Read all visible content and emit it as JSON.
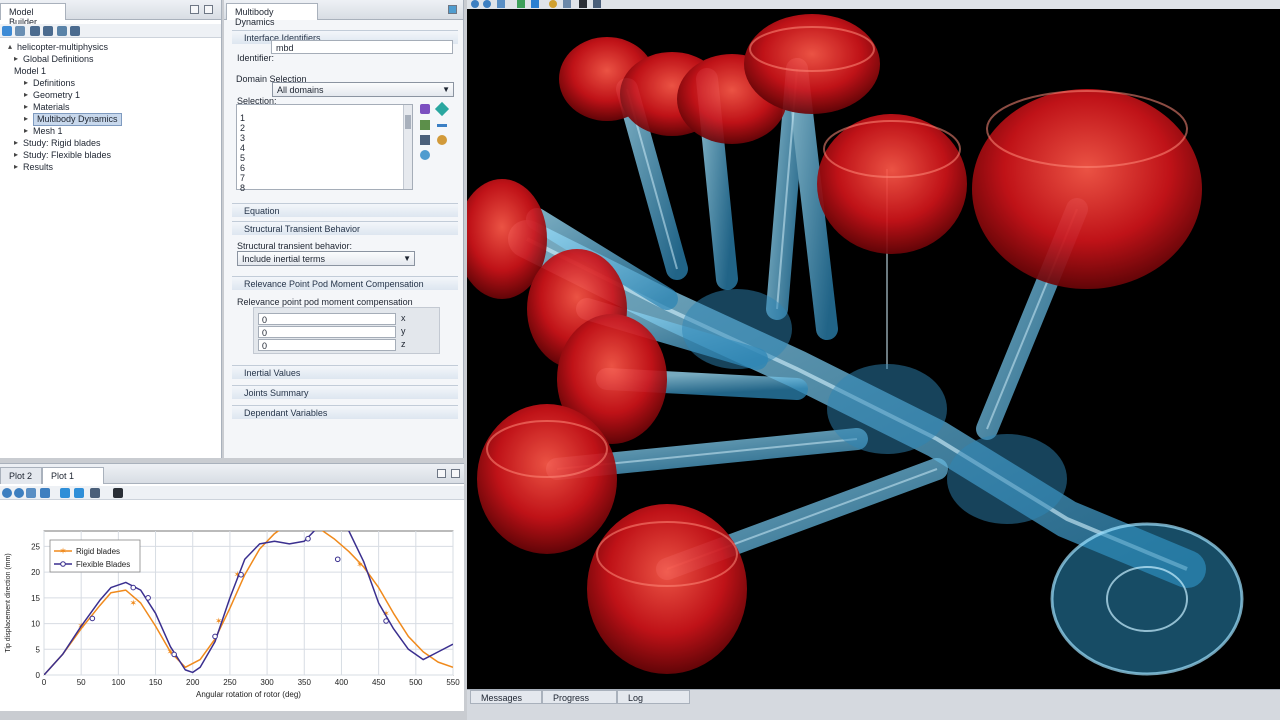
{
  "model_builder": {
    "title": "Model Builder",
    "tree": [
      {
        "label": "helicopter-multiphysics",
        "arrow": "▴",
        "level": 0
      },
      {
        "label": "Global Definitions",
        "arrow": "▸",
        "level": 1
      },
      {
        "label": "Model 1",
        "arrow": "",
        "level": 1
      },
      {
        "label": "Definitions",
        "arrow": "▸",
        "level": 2
      },
      {
        "label": "Geometry 1",
        "arrow": "▸",
        "level": 2
      },
      {
        "label": "Materials",
        "arrow": "▸",
        "level": 2
      },
      {
        "label": "Multibody Dynamics",
        "arrow": "▸",
        "level": 2,
        "selected": true
      },
      {
        "label": "Mesh 1",
        "arrow": "▸",
        "level": 2
      },
      {
        "label": "Study: Rigid blades",
        "arrow": "▸",
        "level": 1
      },
      {
        "label": "Study: Flexible blades",
        "arrow": "▸",
        "level": 1
      },
      {
        "label": "Results",
        "arrow": "▸",
        "level": 1
      }
    ]
  },
  "settings": {
    "title": "Multibody Dynamics",
    "interface_identifiers": "Interface Identifiers",
    "identifier_label": "Identifier:",
    "identifier_value": "mbd",
    "domain_selection": "Domain Selection",
    "selection_label": "Selection:",
    "selection_value": "All domains",
    "domains": [
      "1",
      "2",
      "3",
      "4",
      "5",
      "6",
      "7",
      "8"
    ],
    "equation": "Equation",
    "structural_transient": "Structural Transient Behavior",
    "structural_transient_label": "Structural transient behavior:",
    "structural_transient_value": "Include inertial terms",
    "relevance": "Relevance Point Pod Moment Compensation",
    "relevance_label": "Relevance point pod moment compensation",
    "coords": [
      {
        "value": "0",
        "axis": "x"
      },
      {
        "value": "0",
        "axis": "y"
      },
      {
        "value": "0",
        "axis": "z"
      }
    ],
    "inertial_values": "Inertial Values",
    "joints_summary": "Joints Summary",
    "dependent_variables": "Dependant Variables"
  },
  "plot_tabs": {
    "plot2": "Plot 2",
    "plot1": "Plot 1"
  },
  "bottom_tabs": {
    "messages": "Messages",
    "progress": "Progress",
    "log": "Log"
  },
  "colors": {
    "rigid": "#f08a1c",
    "flexible": "#3a2f8f",
    "grid": "#d7dce3"
  },
  "chart_data": {
    "type": "line",
    "xlabel": "Angular rotation of rotor (deg)",
    "ylabel": "Tip displacement direction (mm)",
    "xlim": [
      0,
      550
    ],
    "ylim": [
      0,
      28
    ],
    "xticks": [
      0,
      50,
      100,
      150,
      200,
      250,
      300,
      350,
      400,
      450,
      500,
      550
    ],
    "yticks": [
      0,
      5,
      10,
      15,
      20,
      25
    ],
    "grid": true,
    "legend_position": "top-left",
    "series": [
      {
        "name": "Rigid blades",
        "marker": "star",
        "x": [
          0,
          25,
          50,
          75,
          90,
          110,
          130,
          150,
          170,
          190,
          210,
          230,
          250,
          270,
          290,
          310,
          330,
          350,
          370,
          390,
          410,
          430,
          450,
          470,
          490,
          510,
          530,
          550
        ],
        "y": [
          0,
          4,
          9,
          13.5,
          16,
          16.5,
          14,
          9.5,
          4.5,
          1.5,
          3,
          7,
          13,
          19.5,
          24.5,
          27.5,
          29.5,
          30,
          28.5,
          26.5,
          24,
          21,
          17,
          12,
          7.5,
          4.5,
          2.5,
          1.5
        ],
        "markers_x": [
          50,
          120,
          170,
          235,
          260,
          350,
          425,
          460
        ],
        "markers_y": [
          9.5,
          14,
          4.5,
          10.5,
          19.5,
          30,
          21.5,
          12
        ]
      },
      {
        "name": "Flexible Blades",
        "marker": "circle",
        "x": [
          0,
          25,
          50,
          75,
          90,
          110,
          130,
          150,
          170,
          190,
          200,
          210,
          230,
          250,
          270,
          290,
          310,
          330,
          350,
          370,
          390,
          410,
          430,
          450,
          470,
          490,
          510,
          530,
          550
        ],
        "y": [
          0,
          4,
          9.5,
          14.5,
          17,
          18,
          16.5,
          12,
          5.5,
          1,
          0.5,
          1.5,
          6.5,
          15,
          22.5,
          25.5,
          26,
          25.5,
          26,
          29,
          30,
          28,
          22,
          14,
          9,
          5,
          3,
          4.5,
          6
        ],
        "markers_x": [
          65,
          120,
          140,
          175,
          230,
          265,
          355,
          395,
          460
        ],
        "markers_y": [
          11,
          17,
          15,
          4,
          7.5,
          19.5,
          26.5,
          22.5,
          10.5
        ]
      }
    ]
  }
}
